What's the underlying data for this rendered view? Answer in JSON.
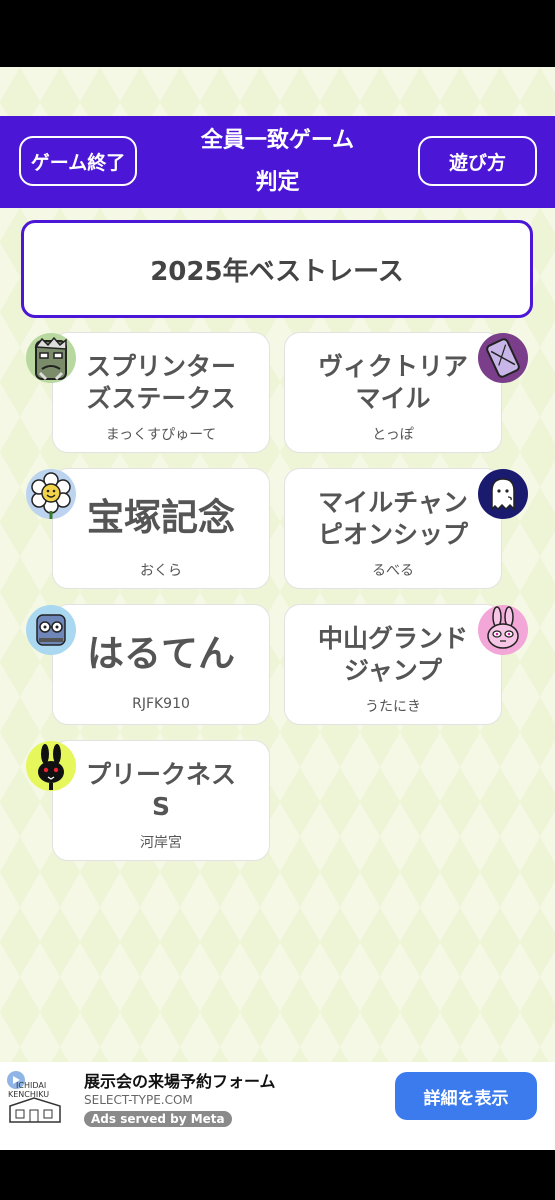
{
  "header": {
    "end_button": "ゲーム終了",
    "title_line1": "全員一致ゲーム",
    "title_line2": "判定",
    "help_button": "遊び方"
  },
  "theme": "2025年ベストレース",
  "cards": [
    {
      "answer": "スプリンター\nズステークス",
      "player": "まっくすぴゅーて",
      "avatar": "grumpy-man-avatar-icon"
    },
    {
      "answer": "ヴィクトリア\nマイル",
      "player": "とっぽ",
      "avatar": "phone-avatar-icon"
    },
    {
      "answer": "宝塚記念",
      "player": "おくら",
      "avatar": "flower-avatar-icon"
    },
    {
      "answer": "マイルチャン\nピオンシップ",
      "player": "るべる",
      "avatar": "ghost-avatar-icon"
    },
    {
      "answer": "はるてん",
      "player": "RJFK910",
      "avatar": "bird-glasses-avatar-icon"
    },
    {
      "answer": "中山グランド\nジャンプ",
      "player": "うたにき",
      "avatar": "pink-rabbit-avatar-icon"
    },
    {
      "answer": "プリークネス\nS",
      "player": "河岸宮",
      "avatar": "black-rabbit-avatar-icon"
    }
  ],
  "ad": {
    "logo_text_1": "ICHIDAI",
    "logo_text_2": "KENCHIKU",
    "title": "展示会の来場予約フォーム",
    "url": "SELECT-TYPE.COM",
    "served_by": "Ads served by Meta",
    "cta": "詳細を表示"
  },
  "colors": {
    "header_purple": "#4b16d6",
    "background": "#eef4d6",
    "cta_blue": "#3b7bee"
  }
}
